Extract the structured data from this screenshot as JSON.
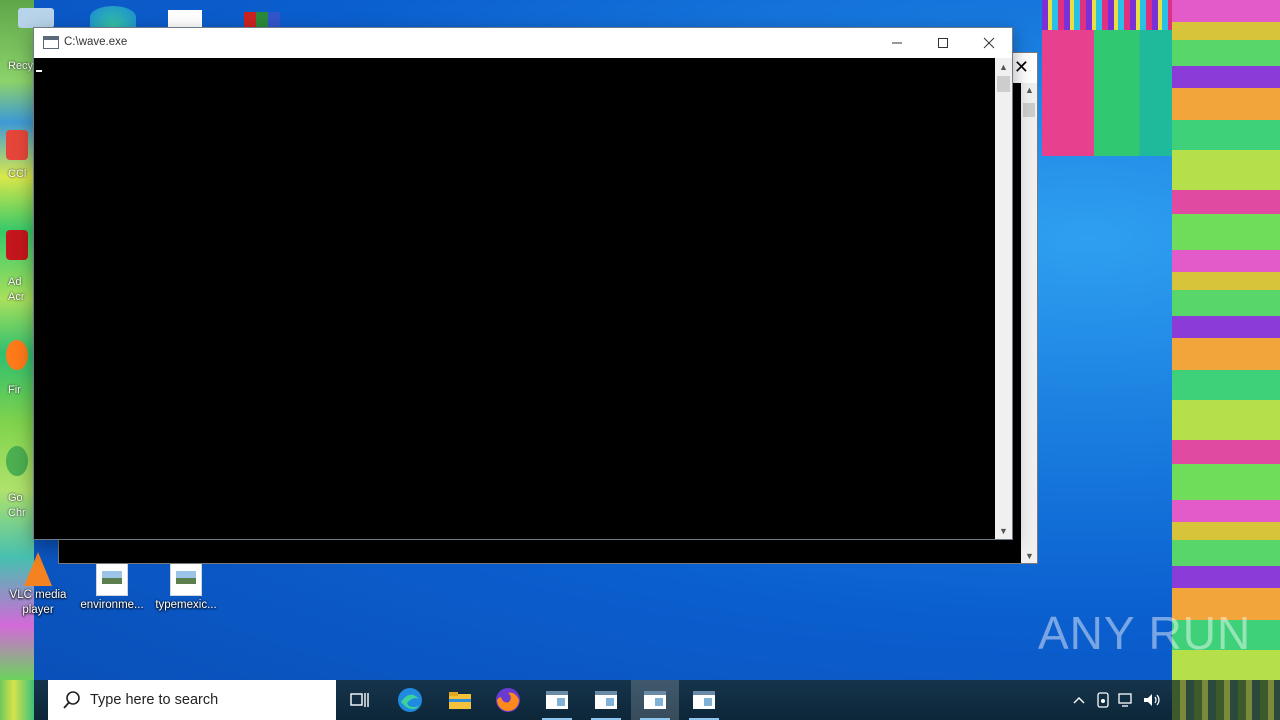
{
  "window": {
    "title": "C:\\wave.exe",
    "minimize_icon": "minimize-icon",
    "maximize_icon": "maximize-icon",
    "close_icon": "close-icon"
  },
  "desktop": {
    "icons": [
      {
        "label": "VLC media player",
        "icon": "vlc-icon"
      },
      {
        "label": "environme...",
        "icon": "image-file-icon"
      },
      {
        "label": "typemexic...",
        "icon": "image-file-icon"
      }
    ],
    "edge_labels": [
      "Recy",
      "CCl",
      "Ad",
      "Acr",
      "Fir",
      "Go",
      "Chr"
    ]
  },
  "taskbar": {
    "search_placeholder": "Type here to search",
    "pinned": [
      "task-view-icon",
      "edge-icon",
      "file-explorer-icon",
      "firefox-icon",
      "app-window-icon",
      "app-window-icon",
      "app-window-icon",
      "app-window-icon"
    ],
    "tray": [
      "chevron-up-icon",
      "device-icon",
      "network-icon",
      "volume-icon"
    ]
  },
  "watermark": "ANY RUN",
  "colors": {
    "desktop_blue": "#0b5fcf",
    "console_bg": "#000000",
    "taskbar_bg": "#0d2638"
  }
}
